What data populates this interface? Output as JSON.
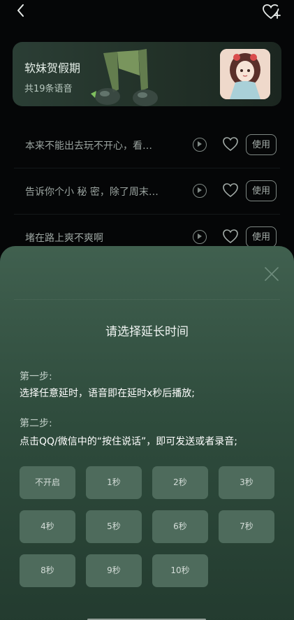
{
  "header": {
    "back_icon": "chevron-left-icon",
    "favorite_icon": "heart-plus-icon"
  },
  "banner": {
    "title": "软妹贺假期",
    "subtitle": "共19条语音"
  },
  "list": {
    "items": [
      {
        "text": "本来不能出去玩不开心，看…",
        "use_label": "使用"
      },
      {
        "text": "告诉你个小 秘 密，除了周末…",
        "use_label": "使用"
      },
      {
        "text": "堵在路上爽不爽啊",
        "use_label": "使用"
      }
    ]
  },
  "sheet": {
    "title": "请选择延长时间",
    "step1_label": "第一步:",
    "step1_text": "选择任意延时，语音即在延时x秒后播放;",
    "step2_label": "第二步:",
    "step2_text": "点击QQ/微信中的“按住说话”，即可发送或者录音;",
    "options": [
      "不开启",
      "1秒",
      "2秒",
      "3秒",
      "4秒",
      "5秒",
      "6秒",
      "7秒",
      "8秒",
      "9秒",
      "10秒"
    ]
  },
  "colors": {
    "background": "#050607",
    "sheet_top": "#40604f",
    "option_bg": "#4e6b5c",
    "banner_bg": "#2b3e35"
  }
}
